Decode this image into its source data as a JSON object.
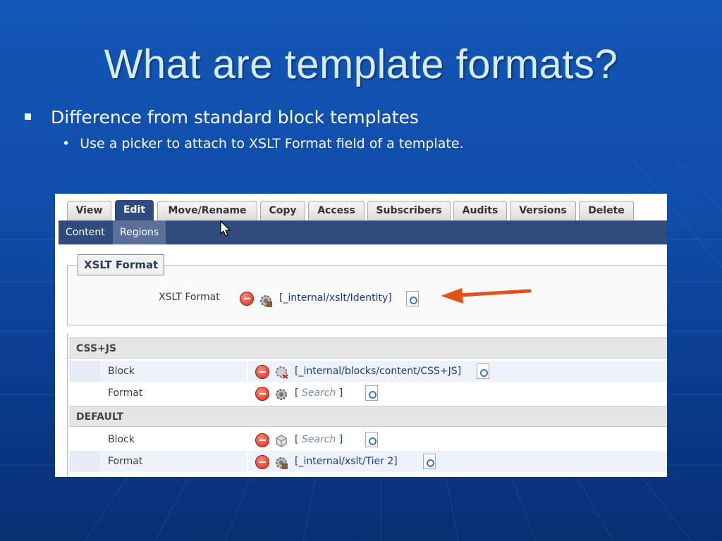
{
  "slide": {
    "title": "What are template formats?",
    "bullet_1": "Difference from standard block templates",
    "bullet_2": "Use a picker to attach to XSLT Format field of a template."
  },
  "tabs": [
    {
      "label": "View",
      "active": false
    },
    {
      "label": "Edit",
      "active": true
    },
    {
      "label": "Move/Rename",
      "active": false
    },
    {
      "label": "Copy",
      "active": false
    },
    {
      "label": "Access",
      "active": false
    },
    {
      "label": "Subscribers",
      "active": false
    },
    {
      "label": "Audits",
      "active": false
    },
    {
      "label": "Versions",
      "active": false
    },
    {
      "label": "Delete",
      "active": false
    }
  ],
  "subtabs": [
    {
      "label": "Content",
      "active": false
    },
    {
      "label": "Regions",
      "active": true
    }
  ],
  "xslt_section": {
    "legend": "XSLT Format",
    "field_label": "XSLT Format",
    "value": "[_internal/xslt/Identity]"
  },
  "sections": [
    {
      "header": "CSS+JS",
      "rows": [
        {
          "label": "Block",
          "value": "[_internal/blocks/content/CSS+JS]",
          "is_search": false
        },
        {
          "label": "Format",
          "value_open": "[",
          "value": "Search",
          "value_close": "]",
          "is_search": true
        }
      ]
    },
    {
      "header": "DEFAULT",
      "rows": [
        {
          "label": "Block",
          "value_open": "[",
          "value": "Search",
          "value_close": "]",
          "is_search": true
        },
        {
          "label": "Format",
          "value": "[_internal/xslt/Tier 2]",
          "is_search": false
        }
      ]
    }
  ],
  "colors": {
    "background": "#1357b6",
    "title": "#d8ecff",
    "nav": "#2f4a7c",
    "arrow": "#e2531c",
    "remove_icon": "#d22a1a"
  },
  "icons": [
    "remove-icon",
    "gear-icon",
    "block-icon",
    "picker-icon",
    "cursor-icon",
    "arrow-icon"
  ]
}
